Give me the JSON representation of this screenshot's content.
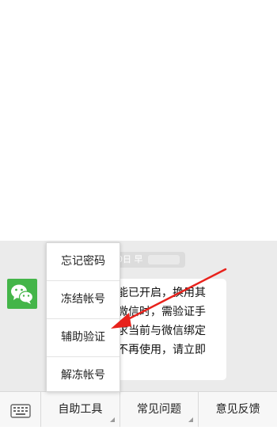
{
  "chat": {
    "timestamp": "0日 早",
    "message_lines": [
      "能已开启，换用其",
      "微信时，需验证手",
      "求当前与微信绑定",
      "不再使用，请立即"
    ]
  },
  "popup_menu": {
    "items": [
      {
        "label": "忘记密码"
      },
      {
        "label": "冻结帐号"
      },
      {
        "label": "辅助验证"
      },
      {
        "label": "解冻帐号"
      }
    ]
  },
  "bottom_menu": {
    "tabs": [
      {
        "label": "自助工具"
      },
      {
        "label": "常见问题"
      },
      {
        "label": "意见反馈"
      }
    ]
  },
  "colors": {
    "brand": "#44b549",
    "arrow": "#e8221c"
  },
  "icons": {
    "keyboard": "keyboard-icon",
    "avatar": "wechat-logo-icon"
  }
}
